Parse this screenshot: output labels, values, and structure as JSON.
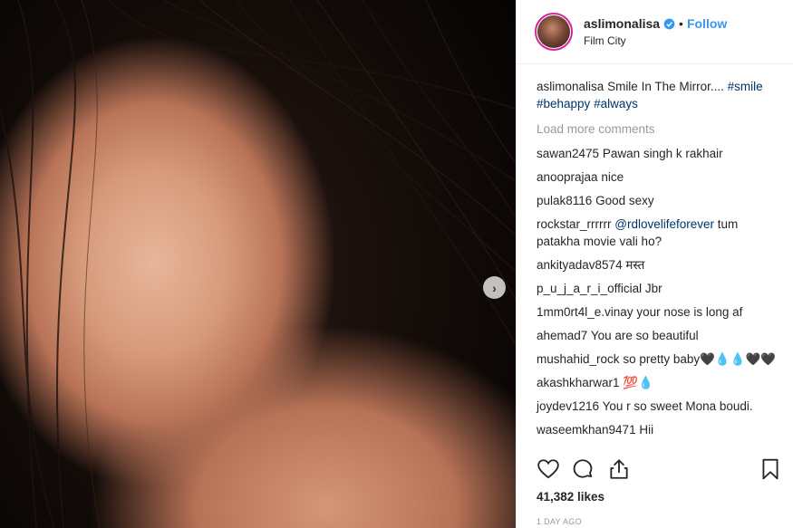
{
  "post": {
    "username": "aslimonalisa",
    "follow_label": "Follow",
    "separator": "•",
    "location": "Film City"
  },
  "caption": {
    "username": "aslimonalisa",
    "text": "Smile In The Mirror....",
    "tag1": "#smile",
    "tag2": "#behappy",
    "tag3": "#always"
  },
  "load_more": "Load more comments",
  "comments": [
    {
      "user": "sawan2475",
      "text": "Pawan singh k rakhair"
    },
    {
      "user": "anooprajaa",
      "text": "nice"
    },
    {
      "user": "pulak8116",
      "text": "Good sexy"
    },
    {
      "user": "rockstar_rrrrrr",
      "mention": "@rdlovelifeforever",
      "text": "tum patakha movie vali ho?"
    },
    {
      "user": "ankityadav8574",
      "text": "मस्त"
    },
    {
      "user": "p_u_j_a_r_i_official",
      "text": "Jbr"
    },
    {
      "user": "1mm0rt4l_e.vinay",
      "text": "your nose is long af"
    },
    {
      "user": "ahemad7",
      "text": "You are so beautiful"
    },
    {
      "user": "mushahid_rock",
      "text": "so pretty baby🖤💧💧🖤🖤"
    },
    {
      "user": "akashkharwar1",
      "text": "💯💧"
    },
    {
      "user": "joydev1216",
      "text": "You r so sweet Mona boudi."
    },
    {
      "user": "waseemkhan9471",
      "text": "Hii"
    }
  ],
  "likes": "41,382 likes",
  "timestamp": "1 DAY AGO",
  "colors": {
    "accent": "#3897f0",
    "hashtag": "#003569",
    "muted": "#999999"
  }
}
